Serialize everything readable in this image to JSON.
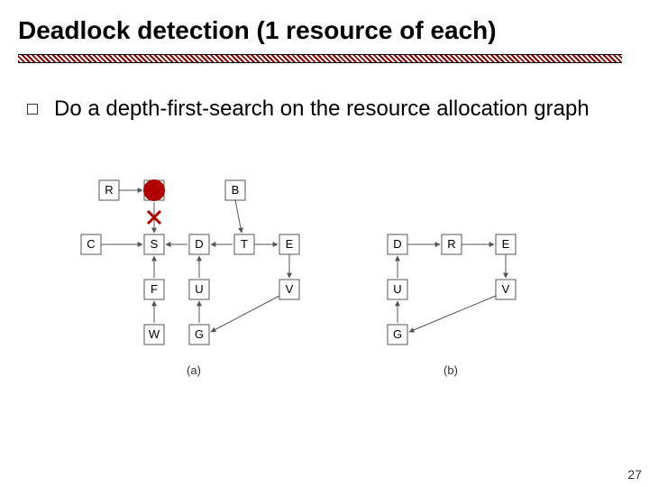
{
  "title": "Deadlock detection (1 resource of each)",
  "bullet": "Do a depth-first-search on the resource allocation graph",
  "page_number": "27",
  "graph_a": {
    "label": "(a)",
    "nodes": [
      "R",
      "A",
      "B",
      "C",
      "S",
      "D",
      "T",
      "E",
      "F",
      "U",
      "V",
      "W",
      "G"
    ],
    "edges": [
      [
        "R",
        "A"
      ],
      [
        "A",
        "S"
      ],
      [
        "C",
        "S"
      ],
      [
        "S",
        "D"
      ],
      [
        "D",
        "T"
      ],
      [
        "T",
        "E"
      ],
      [
        "E",
        "V"
      ],
      [
        "V",
        "G"
      ],
      [
        "G",
        "U"
      ],
      [
        "U",
        "D"
      ],
      [
        "F",
        "S"
      ],
      [
        "W",
        "F"
      ],
      [
        "B",
        "T"
      ]
    ],
    "highlight": {
      "dot_over": "A",
      "cross_between": [
        "A",
        "S"
      ]
    }
  },
  "graph_b": {
    "label": "(b)",
    "nodes": [
      "D",
      "R",
      "E",
      "U",
      "V",
      "G"
    ],
    "edges": [
      [
        "D",
        "R"
      ],
      [
        "R",
        "E"
      ],
      [
        "E",
        "V"
      ],
      [
        "V",
        "G"
      ],
      [
        "G",
        "U"
      ],
      [
        "U",
        "D"
      ]
    ]
  },
  "chart_data": {
    "type": "diagram",
    "description": "Two resource-allocation graphs for deadlock detection via DFS.",
    "graphs": [
      {
        "id": "a",
        "label": "(a)",
        "nodes": [
          "R",
          "A",
          "B",
          "C",
          "S",
          "D",
          "T",
          "E",
          "F",
          "U",
          "V",
          "W",
          "G"
        ],
        "edges": [
          {
            "from": "R",
            "to": "A"
          },
          {
            "from": "A",
            "to": "S"
          },
          {
            "from": "C",
            "to": "S"
          },
          {
            "from": "S",
            "to": "D"
          },
          {
            "from": "D",
            "to": "T"
          },
          {
            "from": "T",
            "to": "E"
          },
          {
            "from": "E",
            "to": "V"
          },
          {
            "from": "V",
            "to": "G"
          },
          {
            "from": "G",
            "to": "U"
          },
          {
            "from": "U",
            "to": "D"
          },
          {
            "from": "F",
            "to": "S"
          },
          {
            "from": "W",
            "to": "F"
          },
          {
            "from": "B",
            "to": "T"
          }
        ],
        "annotation": "red dot on A, red cross on edge A→S"
      },
      {
        "id": "b",
        "label": "(b)",
        "nodes": [
          "D",
          "R",
          "E",
          "U",
          "V",
          "G"
        ],
        "edges": [
          {
            "from": "D",
            "to": "R"
          },
          {
            "from": "R",
            "to": "E"
          },
          {
            "from": "E",
            "to": "V"
          },
          {
            "from": "V",
            "to": "G"
          },
          {
            "from": "G",
            "to": "U"
          },
          {
            "from": "U",
            "to": "D"
          }
        ]
      }
    ]
  }
}
